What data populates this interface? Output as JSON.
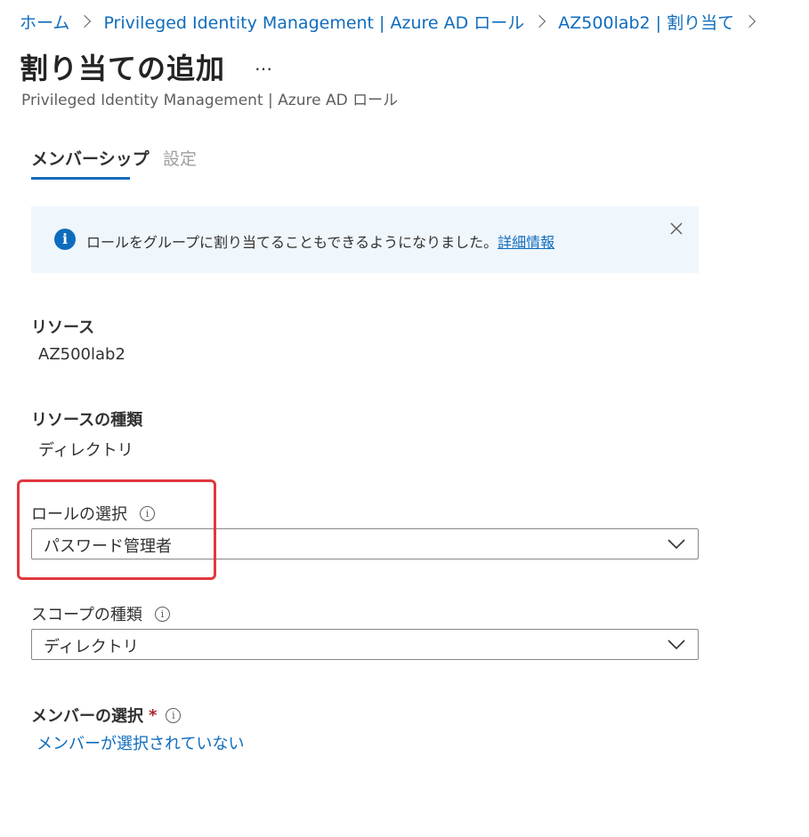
{
  "breadcrumb": {
    "items": [
      "ホーム",
      "Privileged Identity Management | Azure AD ロール",
      "AZ500lab2 | 割り当て"
    ]
  },
  "header": {
    "title": "割り当ての追加",
    "more_label": "…",
    "subtitle": "Privileged Identity Management | Azure AD ロール"
  },
  "tabs": [
    {
      "label": "メンバーシップ",
      "active": true
    },
    {
      "label": "設定",
      "active": false
    }
  ],
  "banner": {
    "icon": "info-icon",
    "text": "ロールをグループに割り当てることもできるようになりました。",
    "link_text": "詳細情報",
    "close_icon": "close-icon"
  },
  "resource": {
    "label": "リソース",
    "value": "AZ500lab2"
  },
  "resource_type": {
    "label": "リソースの種類",
    "value": "ディレクトリ"
  },
  "role_select": {
    "label": "ロールの選択",
    "value": "パスワード管理者"
  },
  "scope_type": {
    "label": "スコープの種類",
    "value": "ディレクトリ"
  },
  "member_select": {
    "label": "メンバーの選択",
    "required_mark": "*",
    "link_text": "メンバーが選択されていない"
  },
  "colors": {
    "accent": "#0f6cbd",
    "banner_bg": "#eff6fc",
    "highlight": "#e0383e",
    "required": "#a4262c"
  }
}
